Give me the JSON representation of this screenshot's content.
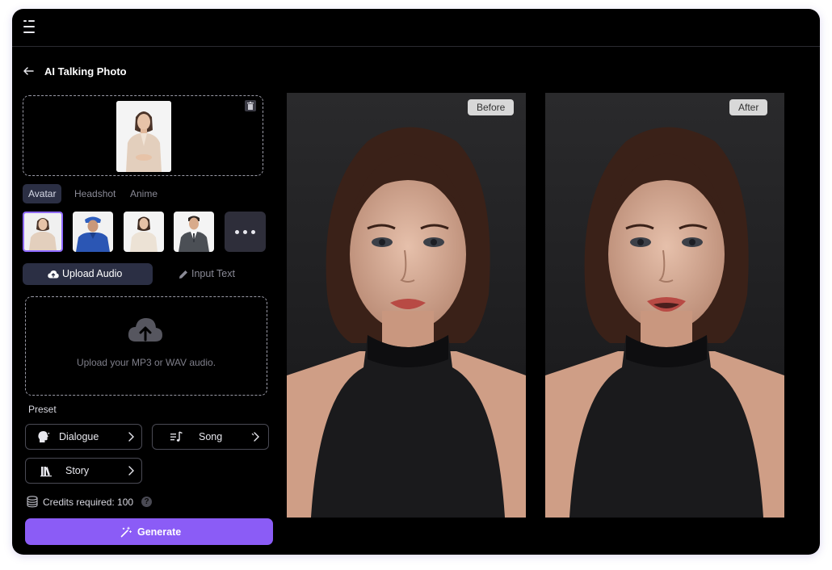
{
  "page": {
    "title": "AI Talking Photo"
  },
  "avatar_tabs": [
    {
      "label": "Avatar",
      "active": true
    },
    {
      "label": "Headshot",
      "active": false
    },
    {
      "label": "Anime",
      "active": false
    }
  ],
  "avatar_thumbnails": [
    {
      "name": "woman-beige-blouse",
      "selected": true
    },
    {
      "name": "doctor-blue-scrubs",
      "selected": false
    },
    {
      "name": "woman-cream-blouse",
      "selected": false
    },
    {
      "name": "man-grey-suit",
      "selected": false
    }
  ],
  "input_modes": {
    "upload_audio": "Upload Audio",
    "input_text": "Input Text"
  },
  "audio_upload": {
    "hint": "Upload your MP3 or WAV audio."
  },
  "preset": {
    "label": "Preset",
    "items": [
      {
        "label": "Dialogue",
        "icon": "speaking-head-icon"
      },
      {
        "label": "Song",
        "icon": "music-note-icon"
      },
      {
        "label": "Story",
        "icon": "books-icon"
      }
    ]
  },
  "credits": {
    "text": "Credits required: 100"
  },
  "generate": {
    "label": "Generate"
  },
  "preview": {
    "before_label": "Before",
    "after_label": "After"
  },
  "colors": {
    "accent": "#8b5cf6",
    "selected_border": "#8f6bff",
    "active_tab_bg": "#2b2f44",
    "background": "#000000"
  }
}
